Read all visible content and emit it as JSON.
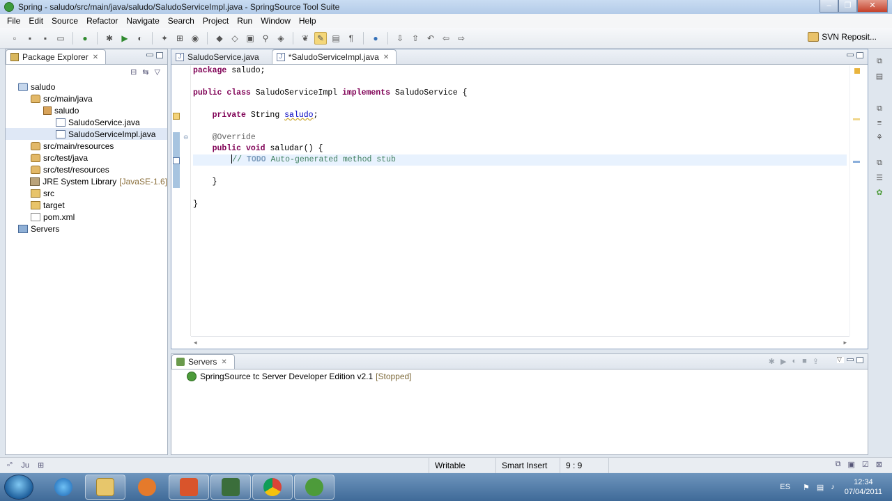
{
  "window": {
    "title": "Spring - saludo/src/main/java/saludo/SaludoServiceImpl.java - SpringSource Tool Suite"
  },
  "menu": [
    "File",
    "Edit",
    "Source",
    "Refactor",
    "Navigate",
    "Search",
    "Project",
    "Run",
    "Window",
    "Help"
  ],
  "perspective": {
    "label": "SVN Reposit..."
  },
  "package_explorer": {
    "title": "Package Explorer",
    "tree": [
      {
        "label": "saludo",
        "level": 0,
        "icon": "project-icon"
      },
      {
        "label": "src/main/java",
        "level": 1,
        "icon": "source-folder-icon"
      },
      {
        "label": "saludo",
        "level": 2,
        "icon": "package-icon"
      },
      {
        "label": "SaludoService.java",
        "level": 3,
        "icon": "java-file-icon"
      },
      {
        "label": "SaludoServiceImpl.java",
        "level": 3,
        "icon": "java-file-icon"
      },
      {
        "label": "src/main/resources",
        "level": 1,
        "icon": "source-folder-icon"
      },
      {
        "label": "src/test/java",
        "level": 1,
        "icon": "source-folder-icon"
      },
      {
        "label": "src/test/resources",
        "level": 1,
        "icon": "source-folder-icon"
      },
      {
        "label": "JRE System Library",
        "suffix": "[JavaSE-1.6]",
        "level": 1,
        "icon": "library-icon"
      },
      {
        "label": "src",
        "level": 1,
        "icon": "folder-icon"
      },
      {
        "label": "target",
        "level": 1,
        "icon": "folder-icon"
      },
      {
        "label": "pom.xml",
        "level": 1,
        "icon": "xml-file-icon"
      },
      {
        "label": "Servers",
        "level": 0,
        "icon": "server-folder-icon"
      }
    ]
  },
  "editor": {
    "tabs": [
      {
        "label": "SaludoService.java",
        "active": false
      },
      {
        "label": "*SaludoServiceImpl.java",
        "active": true
      }
    ],
    "code": {
      "line1": {
        "kw": "package",
        "rest": " saludo;"
      },
      "line2": {
        "kw1": "public",
        "kw2": "class",
        "name": " SaludoServiceImpl ",
        "kw3": "implements",
        "rest": " SaludoService {"
      },
      "line3": {
        "kw": "private",
        "type": " String ",
        "field": "saludo",
        "rest": ";"
      },
      "line4": {
        "ann": "@Override"
      },
      "line5": {
        "kw1": "public",
        "kw2": "void",
        "rest": " saludar() {"
      },
      "line6": {
        "pre": "//",
        "tag": " TODO",
        "rest": " Auto-generated method stub"
      },
      "line7": {
        "text": "}"
      },
      "line8": {
        "text": "}"
      }
    }
  },
  "servers_view": {
    "title": "Servers",
    "entries": [
      {
        "label": "SpringSource tc Server Developer Edition v2.1",
        "status": "[Stopped]"
      }
    ]
  },
  "status_bar": {
    "writable": "Writable",
    "insert_mode": "Smart Insert",
    "position": "9 : 9"
  },
  "taskbar": {
    "language": "ES",
    "time": "12:34",
    "date": "07/04/2011"
  },
  "colors": {
    "keyword": "#7f0055",
    "comment": "#3f7f5f",
    "field": "#0000c0",
    "annotation": "#646464"
  }
}
